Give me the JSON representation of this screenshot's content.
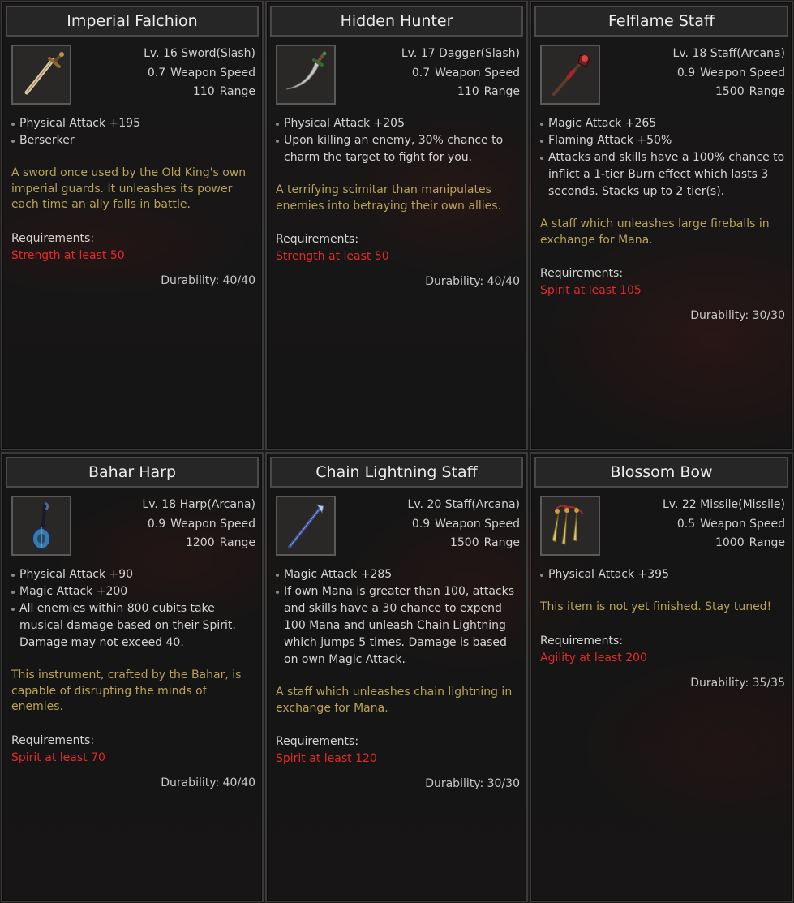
{
  "items": [
    {
      "name": "Imperial Falchion",
      "level_type": "Lv. 16 Sword(Slash)",
      "speed": "0.7",
      "speed_label": "Weapon Speed",
      "range": "110",
      "range_label": "Range",
      "icon": "sword-icon",
      "attrs": [
        "Physical Attack +195",
        "Berserker"
      ],
      "desc": "A sword once used by the Old King's own imperial guards. It unleashes its power each time an ally falls in battle.",
      "req_label": "Requirements:",
      "req": "Strength at least 50",
      "durability": "Durability: 40/40"
    },
    {
      "name": "Hidden Hunter",
      "level_type": "Lv. 17 Dagger(Slash)",
      "speed": "0.7",
      "speed_label": "Weapon Speed",
      "range": "110",
      "range_label": "Range",
      "icon": "dagger-icon",
      "attrs": [
        "Physical Attack +205",
        "Upon killing an enemy, 30% chance to charm the target to fight for you."
      ],
      "desc": "A terrifying scimitar than manipulates enemies into betraying their own allies.",
      "req_label": "Requirements:",
      "req": "Strength at least 50",
      "durability": "Durability: 40/40"
    },
    {
      "name": "Felflame Staff",
      "level_type": "Lv. 18 Staff(Arcana)",
      "speed": "0.9",
      "speed_label": "Weapon Speed",
      "range": "1500",
      "range_label": "Range",
      "icon": "fire-staff-icon",
      "attrs": [
        "Magic Attack +265",
        "Flaming Attack +50%",
        "Attacks and skills have a 100% chance to inflict a 1-tier Burn effect which lasts 3 seconds. Stacks up to 2 tier(s)."
      ],
      "desc": "A staff which unleashes large fireballs in exchange for Mana.",
      "req_label": "Requirements:",
      "req": "Spirit at least 105",
      "durability": "Durability: 30/30"
    },
    {
      "name": "Bahar Harp",
      "level_type": "Lv. 18 Harp(Arcana)",
      "speed": "0.9",
      "speed_label": "Weapon Speed",
      "range": "1200",
      "range_label": "Range",
      "icon": "harp-icon",
      "attrs": [
        "Physical Attack +90",
        "Magic Attack +200",
        "All enemies within 800 cubits take musical damage based on their Spirit. Damage may not exceed 40."
      ],
      "desc": "This instrument, crafted by the Bahar, is capable of disrupting the minds of enemies.",
      "req_label": "Requirements:",
      "req": "Spirit at least 70",
      "durability": "Durability: 40/40"
    },
    {
      "name": "Chain Lightning Staff",
      "level_type": "Lv. 20 Staff(Arcana)",
      "speed": "0.9",
      "speed_label": "Weapon Speed",
      "range": "1500",
      "range_label": "Range",
      "icon": "lightning-staff-icon",
      "attrs": [
        "Magic Attack +285",
        "If own Mana is greater than 100, attacks and skills have a 30 chance to expend 100 Mana and unleash Chain Lightning which jumps 5 times. Damage is based on own Magic Attack."
      ],
      "desc": "A staff which unleashes chain lightning in exchange for Mana.",
      "req_label": "Requirements:",
      "req": "Spirit at least 120",
      "durability": "Durability: 30/30"
    },
    {
      "name": "Blossom Bow",
      "level_type": "Lv. 22 Missile(Missile)",
      "speed": "0.5",
      "speed_label": "Weapon Speed",
      "range": "1000",
      "range_label": "Range",
      "icon": "darts-icon",
      "attrs": [
        "Physical Attack +395"
      ],
      "desc": "This item is not yet finished. Stay tuned!",
      "req_label": "Requirements:",
      "req": "Agility at least 200",
      "durability": "Durability: 35/35"
    }
  ]
}
